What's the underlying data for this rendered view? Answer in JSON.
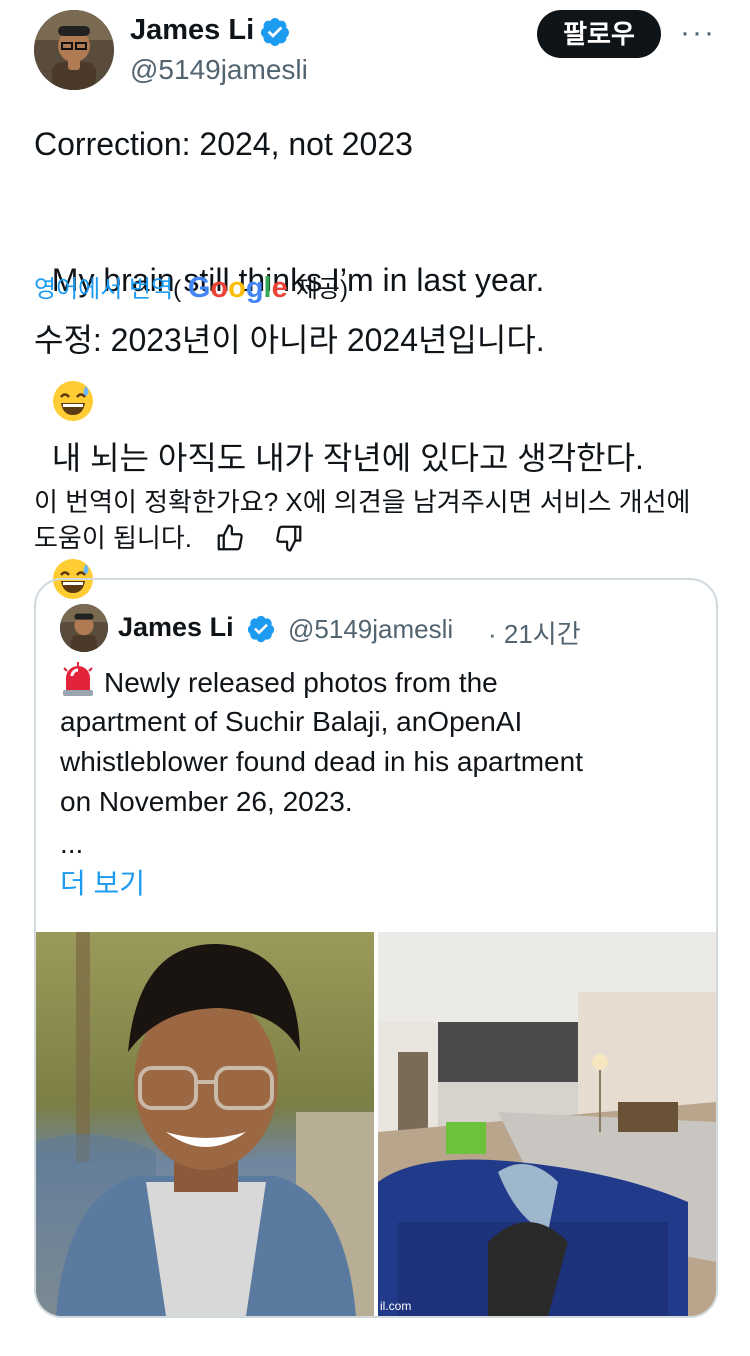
{
  "author": {
    "name": "James Li",
    "handle": "@5149jamesli",
    "follow_label": "팔로우",
    "more_label": "···"
  },
  "post": {
    "line1": "Correction: 2024, not 2023",
    "line2": "My brain still thinks I’m in last year.",
    "emoji": "sweat-smile-emoji"
  },
  "translation": {
    "link": "영어에서 번역",
    "paren_open": "(",
    "google": "Google",
    "provided": " 제공)",
    "line1": "수정: 2023년이 아니라 2024년입니다.",
    "line2": "내 뇌는 아직도 내가 작년에 있다고 생각한다."
  },
  "feedback": {
    "line1": "이 번역이 정확한가요? X에 의견을 남겨주시면 서비스 개선에",
    "line2": "도움이 됩니다.",
    "thumbs_up_icon": "thumbs-up-icon",
    "thumbs_down_icon": "thumbs-down-icon"
  },
  "quote": {
    "name": "James Li",
    "handle": "@5149jamesli",
    "time": "· 21시간",
    "siren": "siren-emoji",
    "text_line1": "Newly released photos from the",
    "text_line2": "apartment of Suchir Balaji, anOpenAI",
    "text_line3": "whistleblower found dead in his apartment",
    "text_line4": "on November 26, 2023.",
    "ellipsis": "...",
    "show_more": "더 보기",
    "watermark": "il.com"
  },
  "colors": {
    "accent": "#1d9bf0",
    "verified": "#1d9bf0",
    "text": "#0f1419",
    "muted": "#536471",
    "border": "#cfd9de"
  }
}
